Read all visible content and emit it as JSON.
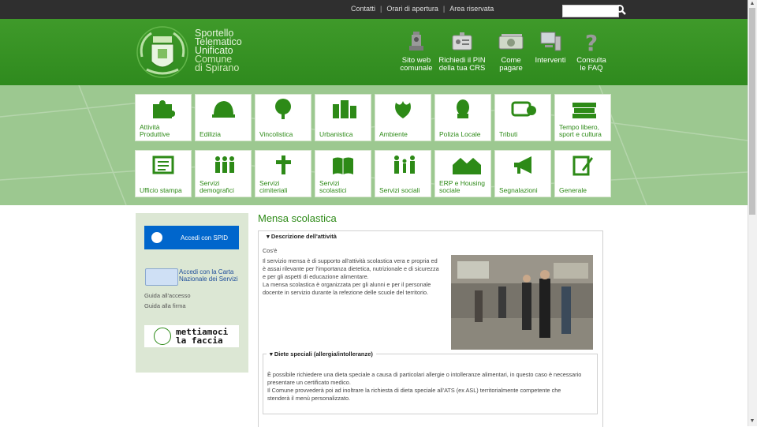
{
  "top": {
    "links": [
      "Contatti",
      "Orari di apertura",
      "Area riservata"
    ],
    "search_placeholder": ""
  },
  "brand": {
    "line1": "Sportello",
    "line2": "Telematico",
    "line3": "Unificato",
    "line4": "Comune",
    "line5": "di Spirano"
  },
  "header_icons": [
    {
      "l1": "Sito web",
      "l2": "comunale",
      "icon": "municipal-building-icon"
    },
    {
      "l1": "Richiedi il PIN",
      "l2": "della tua CRS",
      "icon": "id-badge-icon"
    },
    {
      "l1": "Come",
      "l2": "pagare",
      "icon": "banknote-icon"
    },
    {
      "l1": "Interventi",
      "l2": "",
      "icon": "computer-icon"
    },
    {
      "l1": "Consulta",
      "l2": "le FAQ",
      "icon": "question-mark-icon"
    }
  ],
  "tiles_row1": [
    {
      "l1": "Attività",
      "l2": "Produttive",
      "icon": "puzzle-icon"
    },
    {
      "l1": "Edilizia",
      "l2": "",
      "icon": "helmet-icon"
    },
    {
      "l1": "Vincolistica",
      "l2": "",
      "icon": "tree-icon"
    },
    {
      "l1": "Urbanistica",
      "l2": "",
      "icon": "urban-blocks-icon"
    },
    {
      "l1": "Ambiente",
      "l2": "",
      "icon": "leaf-icon"
    },
    {
      "l1": "Polizia Locale",
      "l2": "",
      "icon": "police-cap-icon"
    },
    {
      "l1": "Tributi",
      "l2": "",
      "icon": "money-icon"
    },
    {
      "l1": "Tempo libero,",
      "l2": "sport e cultura",
      "icon": "books-icon"
    }
  ],
  "tiles_row2": [
    {
      "l1": "Ufficio stampa",
      "l2": "",
      "icon": "newspaper-icon"
    },
    {
      "l1": "Servizi",
      "l2": "demografici",
      "icon": "people-icon"
    },
    {
      "l1": "Servizi",
      "l2": "cimiteriali",
      "icon": "cross-icon"
    },
    {
      "l1": "Servizi",
      "l2": "scolastici",
      "icon": "open-book-icon"
    },
    {
      "l1": "Servizi sociali",
      "l2": "",
      "icon": "family-icon"
    },
    {
      "l1": "ERP e Housing",
      "l2": "sociale",
      "icon": "houses-icon"
    },
    {
      "l1": "Segnalazioni",
      "l2": "",
      "icon": "megaphone-icon"
    },
    {
      "l1": "Generale",
      "l2": "",
      "icon": "pen-paper-icon"
    }
  ],
  "sidebar": {
    "spid_label": "Accedi con SPID",
    "crs_l1": "Accedi con la Carta",
    "crs_l2": "Nazionale dei Servizi",
    "guide_access": "Guida all'accesso",
    "guide_sign": "Guida alla firma",
    "face_l1": "mettiamoci",
    "face_l2": "la faccia"
  },
  "main": {
    "title": "Mensa scolastica",
    "legend1": "Descrizione dell'attività",
    "intro": "Cos'è",
    "p1a": "Il servizio mensa è di supporto all'attività scolastica vera e propria ed",
    "p1b": "è assai rilevante per l'importanza dietetica, nutrizionale e di sicurezza",
    "p1c": "e per gli aspetti di educazione alimentare.",
    "p2a": "La mensa scolastica è organizzata per gli alunni e per il personale",
    "p2b": "docente in servizio durante la refezione delle scuole del territorio.",
    "legend2": "Diete speciali (allergia/intolleranze)",
    "d1": "È possibile richiedere una dieta speciale a causa di particolari allergie o intolleranze alimentari, in questo caso è necessario",
    "d2": "presentare un certificato medico.",
    "d3": "Il Comune provvederà poi ad inoltrare la richiesta di dieta speciale all'ATS (ex ASL) territorialmente competente che",
    "d4": "stenderà il menù personalizzato."
  },
  "colors": {
    "brand_green": "#2d8a17",
    "header_green": "#3f9a2a",
    "band": "#9cc890",
    "spid_blue": "#0066cc"
  }
}
